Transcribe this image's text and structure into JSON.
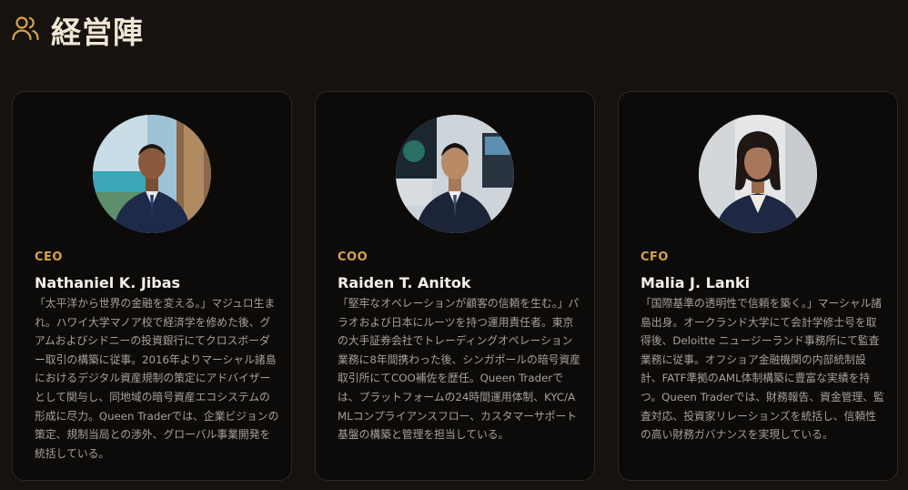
{
  "section": {
    "title": "経営陣",
    "icon": "users-icon",
    "accent": "#d9a24a"
  },
  "members": [
    {
      "role": "CEO",
      "name": "Nathaniel K. Jibas",
      "bio": "「太平洋から世界の金融を変える。」マジュロ生まれ。ハワイ大学マノア校で経済学を修めた後、グアムおよびシドニーの投資銀行にてクロスボーダー取引の構築に従事。2016年よりマーシャル諸島におけるデジタル資産規制の策定にアドバイザーとして関与し、同地域の暗号資産エコシステムの形成に尽力。Queen Traderでは、企業ビジョンの策定、規制当局との渉外、グローバル事業開発を統括している。"
    },
    {
      "role": "COO",
      "name": "Raiden T. Anitok",
      "bio": "「堅牢なオペレーションが顧客の信頼を生む。」パラオおよび日本にルーツを持つ運用責任者。東京の大手証券会社でトレーディングオペレーション業務に8年間携わった後、シンガポールの暗号資産取引所にてCOO補佐を歴任。Queen Traderでは、プラットフォームの24時間運用体制、KYC/AMLコンプライアンスフロー、カスタマーサポート基盤の構築と管理を担当している。"
    },
    {
      "role": "CFO",
      "name": "Malia J. Lanki",
      "bio": "「国際基準の透明性で信頼を築く。」マーシャル諸島出身。オークランド大学にて会計学修士号を取得後、Deloitte ニュージーランド事務所にて監査業務に従事。オフショア金融機関の内部統制設計、FATF準拠のAML体制構築に豊富な実績を持つ。Queen Traderでは、財務報告、資金管理、監査対応、投資家リレーションズを統括し、信頼性の高い財務ガバナンスを実現している。"
    }
  ]
}
